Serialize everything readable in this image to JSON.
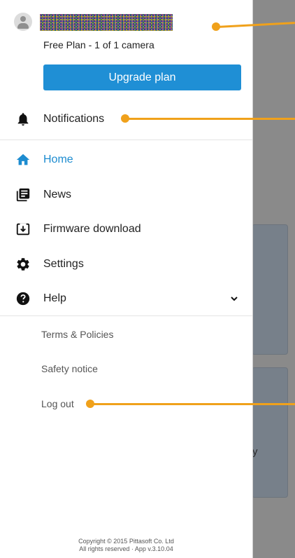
{
  "profile": {
    "plan_text": "Free Plan - 1 of 1 camera",
    "upgrade_label": "Upgrade plan"
  },
  "menu": {
    "notifications": "Notifications",
    "home": "Home",
    "news": "News",
    "firmware": "Firmware download",
    "settings": "Settings",
    "help": "Help"
  },
  "secondary": {
    "terms": "Terms & Policies",
    "safety": "Safety notice",
    "logout": "Log out"
  },
  "footer": {
    "copyright": "Copyright © 2015 Pittasoft Co. Ltd",
    "rights": "All rights reserved · App v.3.10.04"
  },
  "background": {
    "partial_char": "y"
  },
  "colors": {
    "accent": "#1d8cd0",
    "button": "#1f8fd5",
    "callout": "#f0a11b"
  }
}
